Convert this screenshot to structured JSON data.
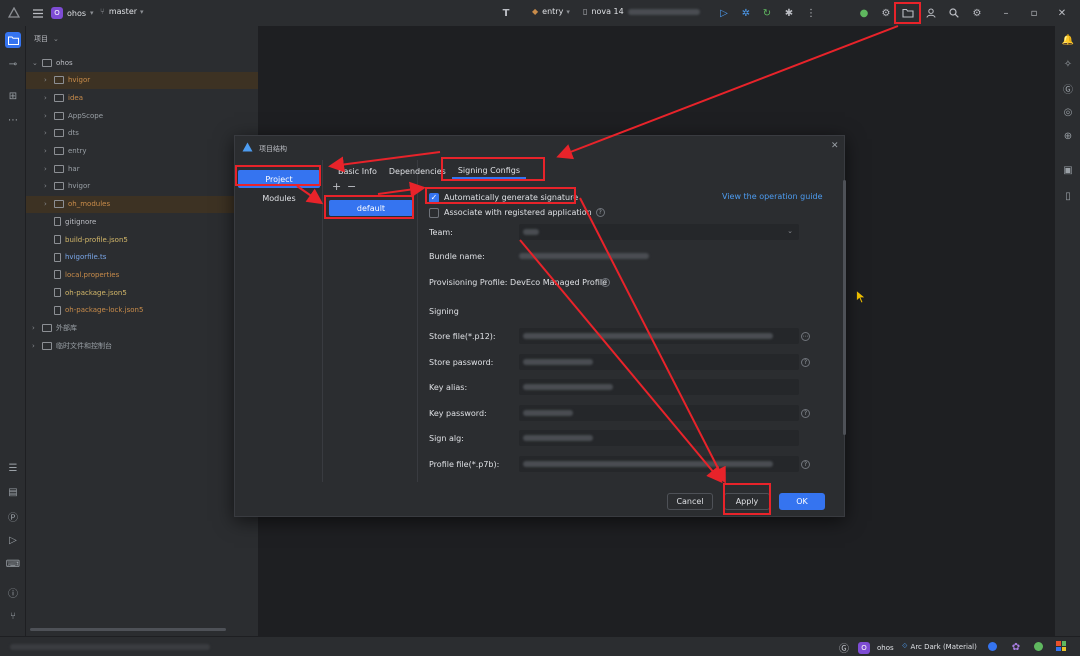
{
  "titlebar": {
    "project_badge": "O",
    "project_name": "ohos",
    "branch": "master",
    "run_config": "entry",
    "device": "nova 14"
  },
  "project_panel": {
    "header": "项目",
    "tree": [
      {
        "label": "ohos",
        "type": "folder",
        "indent": 0,
        "expanded": true,
        "color": "white"
      },
      {
        "label": "hvigor",
        "type": "folder",
        "indent": 1,
        "color": "orange",
        "highlight": true
      },
      {
        "label": "idea",
        "type": "folder",
        "indent": 1,
        "color": "orange"
      },
      {
        "label": "AppScope",
        "type": "folder",
        "indent": 1,
        "color": "gray"
      },
      {
        "label": "dts",
        "type": "folder",
        "indent": 1,
        "color": "gray"
      },
      {
        "label": "entry",
        "type": "folder",
        "indent": 1,
        "color": "gray"
      },
      {
        "label": "har",
        "type": "folder",
        "indent": 1,
        "color": "gray"
      },
      {
        "label": "hvigor",
        "type": "folder",
        "indent": 1,
        "color": "gray"
      },
      {
        "label": "oh_modules",
        "type": "folder",
        "indent": 1,
        "color": "orange",
        "highlight": true
      },
      {
        "label": "gitignore",
        "type": "file",
        "indent": 1,
        "color": "white"
      },
      {
        "label": "build-profile.json5",
        "type": "file",
        "indent": 1,
        "color": "yellow"
      },
      {
        "label": "hvigorfile.ts",
        "type": "file",
        "indent": 1,
        "color": "blue"
      },
      {
        "label": "local.properties",
        "type": "file",
        "indent": 1,
        "color": "orange"
      },
      {
        "label": "oh-package.json5",
        "type": "file",
        "indent": 1,
        "color": "yellow"
      },
      {
        "label": "oh-package-lock.json5",
        "type": "file",
        "indent": 1,
        "color": "orange"
      },
      {
        "label": "外部库",
        "type": "folder",
        "indent": 0,
        "color": "gray"
      },
      {
        "label": "临时文件和控制台",
        "type": "folder",
        "indent": 0,
        "color": "gray"
      }
    ]
  },
  "dialog": {
    "title": "项目结构",
    "nav": [
      "Project",
      "Modules"
    ],
    "list_item": "default",
    "list_add": "+",
    "list_remove": "−",
    "tabs": [
      "Basic Info",
      "Dependencies",
      "Signing Configs"
    ],
    "auto_sign": "Automatically generate signature",
    "associate": "Associate with registered application",
    "guide_link": "View the operation guide",
    "team_label": "Team:",
    "bundle_label": "Bundle name:",
    "profile_label": "Provisioning Profile: DevEco Managed Profile",
    "signing_header": "Signing",
    "fields": [
      {
        "label": "Store file(*.p12):",
        "help": false,
        "folder": true
      },
      {
        "label": "Store password:",
        "help": true
      },
      {
        "label": "Key alias:",
        "help": false
      },
      {
        "label": "Key password:",
        "help": true
      },
      {
        "label": "Sign alg:",
        "help": false
      },
      {
        "label": "Profile file(*.p7b):",
        "help": true
      }
    ],
    "buttons": {
      "cancel": "Cancel",
      "apply": "Apply",
      "ok": "OK"
    }
  },
  "statusbar": {
    "project_badge": "O",
    "project_name": "ohos",
    "theme": "Arc Dark (Material)"
  },
  "colors": {
    "accent": "#3574f0",
    "annotation": "#e8232a",
    "link": "#4d9cf0"
  }
}
